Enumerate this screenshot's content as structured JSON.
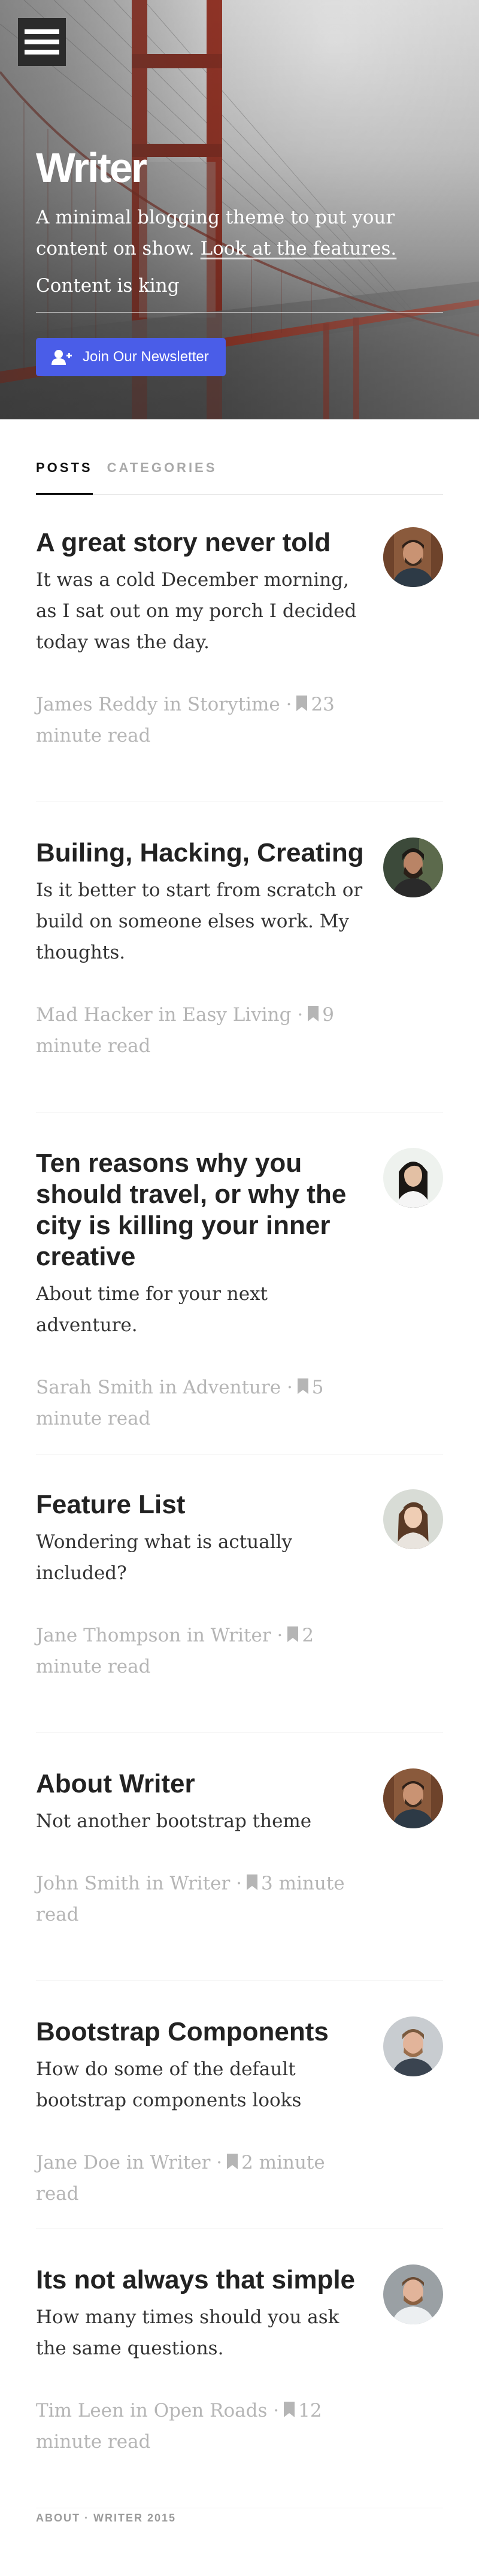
{
  "hero": {
    "site_title": "Writer",
    "tagline": "A minimal blogging theme to put your content on show.",
    "tagline_link": "Look at the features.",
    "subline": "Content is king",
    "newsletter_label": "Join Our Newsletter"
  },
  "tabs": [
    {
      "label": "POSTS",
      "active": true
    },
    {
      "label": "CATEGORIES",
      "active": false
    }
  ],
  "posts": [
    {
      "title": "A great story never told",
      "excerpt": "It was a cold December morning, as I sat out on my porch I decided today was the day.",
      "author": "James Reddy",
      "category": "Storytime",
      "read_time": "23 minute read"
    },
    {
      "title": "Builing, Hacking, Creating",
      "excerpt": "Is it better to start from scratch or build on someone elses work. My thoughts.",
      "author": "Mad Hacker",
      "category": "Easy Living",
      "read_time": "9 minute read"
    },
    {
      "title": "Ten reasons why you should travel, or why the city is killing your inner creative",
      "excerpt": "About time for your next adventure.",
      "author": "Sarah Smith",
      "category": "Adventure",
      "read_time": "5 minute read"
    },
    {
      "title": "Feature List",
      "excerpt": "Wondering what is actually included?",
      "author": "Jane Thompson",
      "category": "Writer",
      "read_time": "2 minute read"
    },
    {
      "title": "About Writer",
      "excerpt": "Not another bootstrap theme",
      "author": "John Smith",
      "category": "Writer",
      "read_time": "3 minute read"
    },
    {
      "title": "Bootstrap Components",
      "excerpt": "How do some of the default bootstrap components looks",
      "author": "Jane Doe",
      "category": "Writer",
      "read_time": "2 minute read"
    },
    {
      "title": "Its not always that simple",
      "excerpt": "How many times should you ask the same questions.",
      "author": "Tim Leen",
      "category": "Open Roads",
      "read_time": "12 minute read"
    }
  ],
  "labels": {
    "in": "in",
    "sep": "·"
  },
  "footer": {
    "about": "ABOUT",
    "sep": "·",
    "credit": "WRITER 2015"
  },
  "colors": {
    "accent": "#4a5de8",
    "bridge": "#9c3a2a",
    "meta": "#b5b5b5"
  }
}
